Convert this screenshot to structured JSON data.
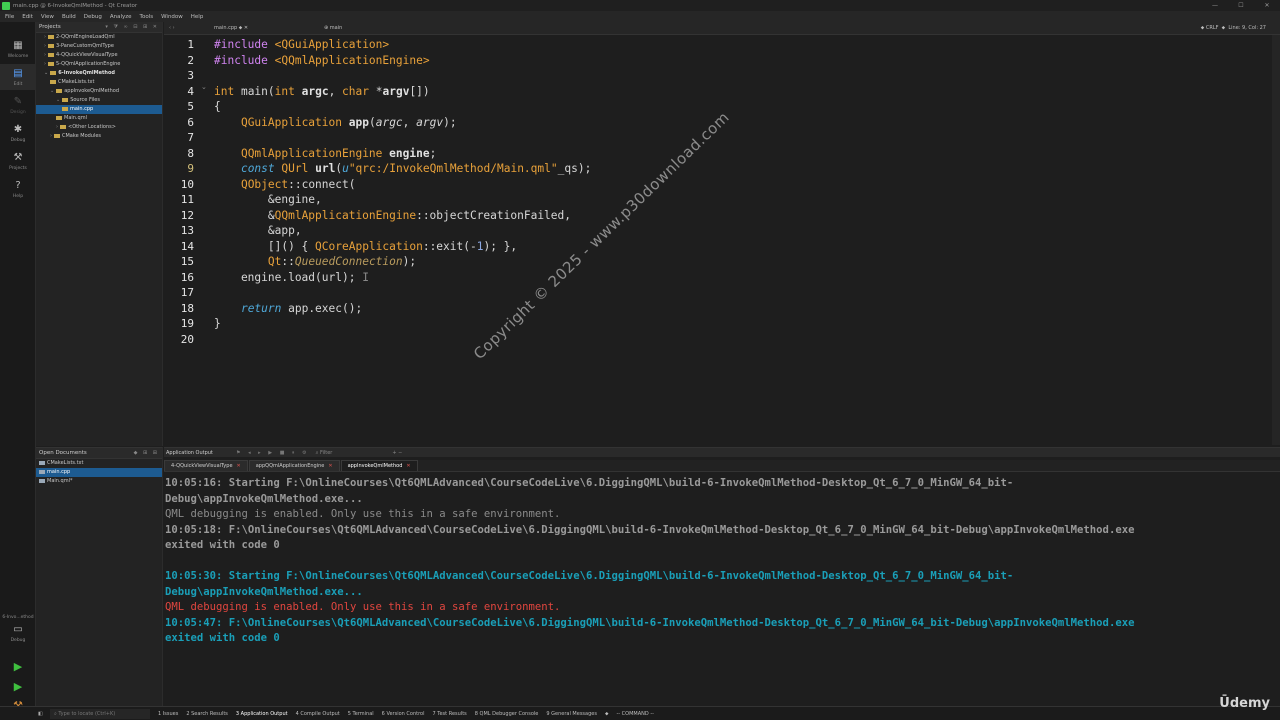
{
  "window": {
    "title": "main.cpp @ 6-InvokeQmlMethod - Qt Creator",
    "buttons": [
      "—",
      "☐",
      "✕"
    ]
  },
  "menu": [
    "File",
    "Edit",
    "View",
    "Build",
    "Debug",
    "Analyze",
    "Tools",
    "Window",
    "Help"
  ],
  "modes": [
    {
      "label": "Welcome",
      "icon": "grid-icon"
    },
    {
      "label": "Edit",
      "icon": "edit-icon"
    },
    {
      "label": "Design",
      "icon": "design-icon"
    },
    {
      "label": "Debug",
      "icon": "bug-icon"
    },
    {
      "label": "Projects",
      "icon": "wrench-icon"
    },
    {
      "label": "Help",
      "icon": "help-icon"
    }
  ],
  "kit": {
    "project": "6-Invo...ethod",
    "config": "Debug"
  },
  "projects": {
    "title": "Projects",
    "items": [
      {
        "label": "2-QQmlEngineLoadQml",
        "indent": 1,
        "bold": false,
        "selected": false,
        "arrow": "›"
      },
      {
        "label": "3-PaneCustomQmlType",
        "indent": 1,
        "bold": false,
        "selected": false,
        "arrow": "›"
      },
      {
        "label": "4-QQuickViewVisualType",
        "indent": 1,
        "bold": false,
        "selected": false,
        "arrow": "›"
      },
      {
        "label": "5-QQmlApplicationEngine",
        "indent": 1,
        "bold": false,
        "selected": false,
        "arrow": "›"
      },
      {
        "label": "6-InvokeQmlMethod",
        "indent": 1,
        "bold": true,
        "selected": false,
        "arrow": "⌄"
      },
      {
        "label": "CMakeLists.txt",
        "indent": 2,
        "bold": false,
        "selected": false,
        "arrow": ""
      },
      {
        "label": "appInvokeQmlMethod",
        "indent": 2,
        "bold": false,
        "selected": false,
        "arrow": "⌄"
      },
      {
        "label": "Source Files",
        "indent": 3,
        "bold": false,
        "selected": false,
        "arrow": "⌄"
      },
      {
        "label": "main.cpp",
        "indent": 4,
        "bold": false,
        "selected": true,
        "arrow": ""
      },
      {
        "label": "Main.qml",
        "indent": 3,
        "bold": false,
        "selected": false,
        "arrow": ""
      },
      {
        "label": "<Other Locations>",
        "indent": 3,
        "bold": false,
        "selected": false,
        "arrow": "›"
      },
      {
        "label": "CMake Modules",
        "indent": 2,
        "bold": false,
        "selected": false,
        "arrow": "›"
      }
    ]
  },
  "open_documents": {
    "title": "Open Documents",
    "items": [
      {
        "label": "CMakeLists.txt",
        "selected": false
      },
      {
        "label": "main.cpp",
        "selected": true
      },
      {
        "label": "Main.qml*",
        "selected": false
      }
    ]
  },
  "editor": {
    "file": "main.cpp",
    "symbol": "main",
    "encoding": "CRLF",
    "position": "Line: 9, Col: 27",
    "current_line": 9,
    "line_numbers": [
      "1",
      "2",
      "3",
      "4",
      "5",
      "6",
      "7",
      "8",
      "9",
      "10",
      "11",
      "12",
      "13",
      "14",
      "15",
      "16",
      "17",
      "18",
      "19",
      "20"
    ]
  },
  "watermark": "Copyright © 2025 - www.p30download.com",
  "output": {
    "title": "Application Output",
    "filter_placeholder": "Filter",
    "tabs": [
      {
        "label": "4-QQuickViewVisualType",
        "active": false
      },
      {
        "label": "appQQmlApplicationEngine",
        "active": false
      },
      {
        "label": "appInvokeQmlMethod",
        "active": true
      }
    ],
    "lines": [
      {
        "text": "10:05:16: Starting F:\\OnlineCourses\\Qt6QMLAdvanced\\CourseCodeLive\\6.DiggingQML\\build-6-InvokeQmlMethod-Desktop_Qt_6_7_0_MinGW_64_bit-",
        "style": "gbold"
      },
      {
        "text": "Debug\\appInvokeQmlMethod.exe...",
        "style": "gbold"
      },
      {
        "text": "QML debugging is enabled. Only use this in a safe environment.",
        "style": "gray"
      },
      {
        "text": "10:05:18: F:\\OnlineCourses\\Qt6QMLAdvanced\\CourseCodeLive\\6.DiggingQML\\build-6-InvokeQmlMethod-Desktop_Qt_6_7_0_MinGW_64_bit-Debug\\appInvokeQmlMethod.exe",
        "style": "gbold"
      },
      {
        "text": "exited with code 0",
        "style": "gbold"
      },
      {
        "text": "",
        "style": "gray"
      },
      {
        "text": "10:05:30: Starting F:\\OnlineCourses\\Qt6QMLAdvanced\\CourseCodeLive\\6.DiggingQML\\build-6-InvokeQmlMethod-Desktop_Qt_6_7_0_MinGW_64_bit-",
        "style": "blue"
      },
      {
        "text": "Debug\\appInvokeQmlMethod.exe...",
        "style": "blue"
      },
      {
        "text": "QML debugging is enabled. Only use this in a safe environment.",
        "style": "red"
      },
      {
        "text": "10:05:47: F:\\OnlineCourses\\Qt6QMLAdvanced\\CourseCodeLive\\6.DiggingQML\\build-6-InvokeQmlMethod-Desktop_Qt_6_7_0_MinGW_64_bit-Debug\\appInvokeQmlMethod.exe",
        "style": "blue"
      },
      {
        "text": "exited with code 0",
        "style": "blue"
      }
    ]
  },
  "statusbar": {
    "locate_placeholder": "Type to locate (Ctrl+K)",
    "panes": [
      {
        "label": "1 Issues",
        "active": false
      },
      {
        "label": "2 Search Results",
        "active": false
      },
      {
        "label": "3 Application Output",
        "active": true
      },
      {
        "label": "4 Compile Output",
        "active": false
      },
      {
        "label": "5 Terminal",
        "active": false
      },
      {
        "label": "6 Version Control",
        "active": false
      },
      {
        "label": "7 Test Results",
        "active": false
      },
      {
        "label": "8 QML Debugger Console",
        "active": false
      },
      {
        "label": "9 General Messages",
        "active": false
      }
    ],
    "command": "-- COMMAND --"
  },
  "brand": "Ūdemy"
}
